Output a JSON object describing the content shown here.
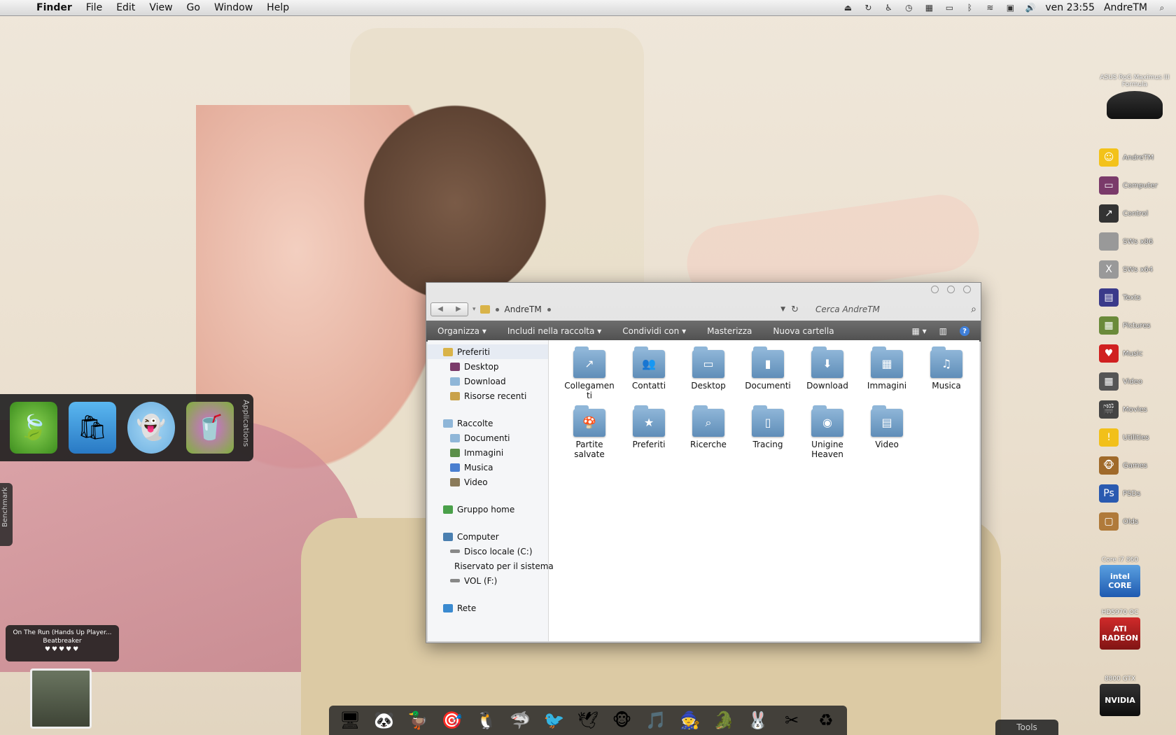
{
  "menubar": {
    "app": "Finder",
    "menus": [
      "File",
      "Edit",
      "View",
      "Go",
      "Window",
      "Help"
    ],
    "clock": "ven 23:55",
    "user": "AndreTM"
  },
  "window": {
    "address": "AndreTM",
    "search_placeholder": "Cerca AndreTM",
    "toolbar": [
      "Organizza",
      "Includi nella raccolta",
      "Condividi con",
      "Masterizza",
      "Nuova cartella"
    ],
    "nav": {
      "favorites": "Preferiti",
      "fav_items": [
        "Desktop",
        "Download",
        "Risorse recenti"
      ],
      "libraries": "Raccolte",
      "lib_items": [
        "Documenti",
        "Immagini",
        "Musica",
        "Video"
      ],
      "homegroup": "Gruppo home",
      "computer": "Computer",
      "comp_items": [
        "Disco locale (C:)",
        "Riservato per il sistema",
        "VOL (F:)"
      ],
      "network": "Rete"
    },
    "folders": [
      {
        "label": "Collegamen ti",
        "icon": "shortcut-arrow-icon"
      },
      {
        "label": "Contatti",
        "icon": "contacts-icon"
      },
      {
        "label": "Desktop",
        "icon": "desktop-icon"
      },
      {
        "label": "Documenti",
        "icon": "documents-icon"
      },
      {
        "label": "Download",
        "icon": "download-arrow-icon"
      },
      {
        "label": "Immagini",
        "icon": "pictures-icon"
      },
      {
        "label": "Musica",
        "icon": "music-note-icon"
      },
      {
        "label": "Partite salvate",
        "icon": "mushroom-icon"
      },
      {
        "label": "Preferiti",
        "icon": "star-icon"
      },
      {
        "label": "Ricerche",
        "icon": "magnifier-icon"
      },
      {
        "label": "Tracing",
        "icon": "document-icon"
      },
      {
        "label": "Unigine Heaven",
        "icon": "firefox-icon"
      },
      {
        "label": "Video",
        "icon": "film-icon"
      }
    ]
  },
  "right_panel": {
    "board": "ASUS RoG Maximus III Formula",
    "items": [
      "AndreTM",
      "Computer",
      "Control",
      "SWs x86",
      "SWs x64",
      "Texts",
      "Pictures",
      "Music",
      "Video",
      "Movies",
      "Utilities",
      "Games",
      "PSDs",
      "Olds"
    ],
    "badges": [
      {
        "caption": "Core i7 860",
        "label": "intel CORE"
      },
      {
        "caption": "HD5970 OC",
        "label": "ATI RADEON"
      },
      {
        "caption": "8800 GTX",
        "label": "NVIDIA"
      }
    ]
  },
  "shelf": {
    "label": "Applications",
    "bench": "Benchmark"
  },
  "nowplaying": {
    "title": "On The Run (Hands Up Player...",
    "artist": "Beatbreaker",
    "stars": "♥♥♥♥♥"
  },
  "tools_label": "Tools"
}
